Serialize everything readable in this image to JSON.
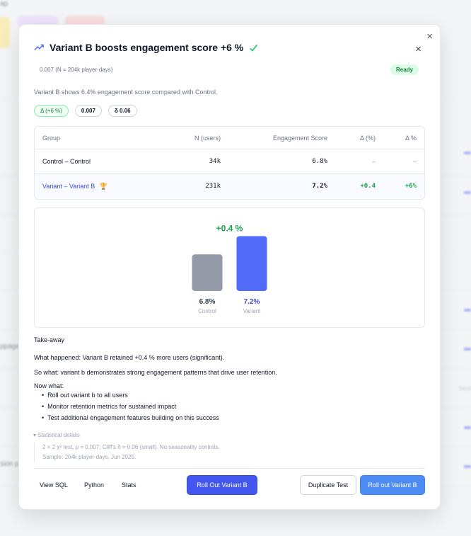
{
  "background": {
    "fragments": [
      "ap",
      "ppage",
      "sion pla",
      "Neut"
    ]
  },
  "modal": {
    "title": "Variant B boosts engagement score +6 %",
    "meta": "0.007 (N = 204k player-days)",
    "status_badge": "Ready",
    "summary": "Variant B shows 6.4% engagement score compared with Control.",
    "pills": [
      "Δ (+6 %)",
      "0.007",
      "δ 0.06"
    ],
    "close_glyph": "×"
  },
  "table": {
    "headers": [
      "Group",
      "N (users)",
      "Engagement Score",
      "Δ (%)",
      "Δ %"
    ],
    "rows": [
      {
        "group": "Control – Control",
        "n": "34k",
        "score": "6.8%",
        "delta_pp": "–",
        "delta_pct": "–"
      },
      {
        "group": "Variant – Variant B",
        "trophy": "🏆",
        "n": "231k",
        "score": "7.2%",
        "delta_pp": "+0.4",
        "delta_pct": "+6%"
      }
    ]
  },
  "chart_data": {
    "type": "bar",
    "categories": [
      "Control",
      "Variant"
    ],
    "values": [
      6.8,
      7.2
    ],
    "value_labels": [
      "6.8%",
      "7.2%"
    ],
    "annotation": "+0.4 %",
    "colors": [
      "#959aa8",
      "#4f6bf7"
    ],
    "label_colors": [
      "#374151",
      "#3b4ccf"
    ],
    "annotation_color": "#16a34a",
    "title": "",
    "xlabel": "",
    "ylabel": ""
  },
  "takeaway": {
    "heading": "Take-away",
    "what_happened_label": "What happened:",
    "what_happened": "Variant B retained +0.4 % more users (significant).",
    "so_what_label": "So what:",
    "so_what": "variant b demonstrates strong engagement patterns that drive user retention.",
    "now_what_label": "Now what:",
    "actions": [
      "Roll out variant b to all users",
      "Monitor retention metrics for sustained impact",
      "Test additional engagement features building on this success"
    ]
  },
  "stats": {
    "toggle_label": "▾ Statistical details",
    "line1": "2 × 2 χ² test, p = 0.007; Cliff's δ = 0.06 (small). No seasonality controls.",
    "line2": "Sample: 204k player-days, Jun 2025."
  },
  "footer": {
    "view_sql": "View SQL",
    "python": "Python",
    "stats": "Stats",
    "roll_out_primary": "Roll Out Variant B",
    "duplicate": "Duplicate Test",
    "roll_out_secondary": "Roll out Variant B"
  }
}
